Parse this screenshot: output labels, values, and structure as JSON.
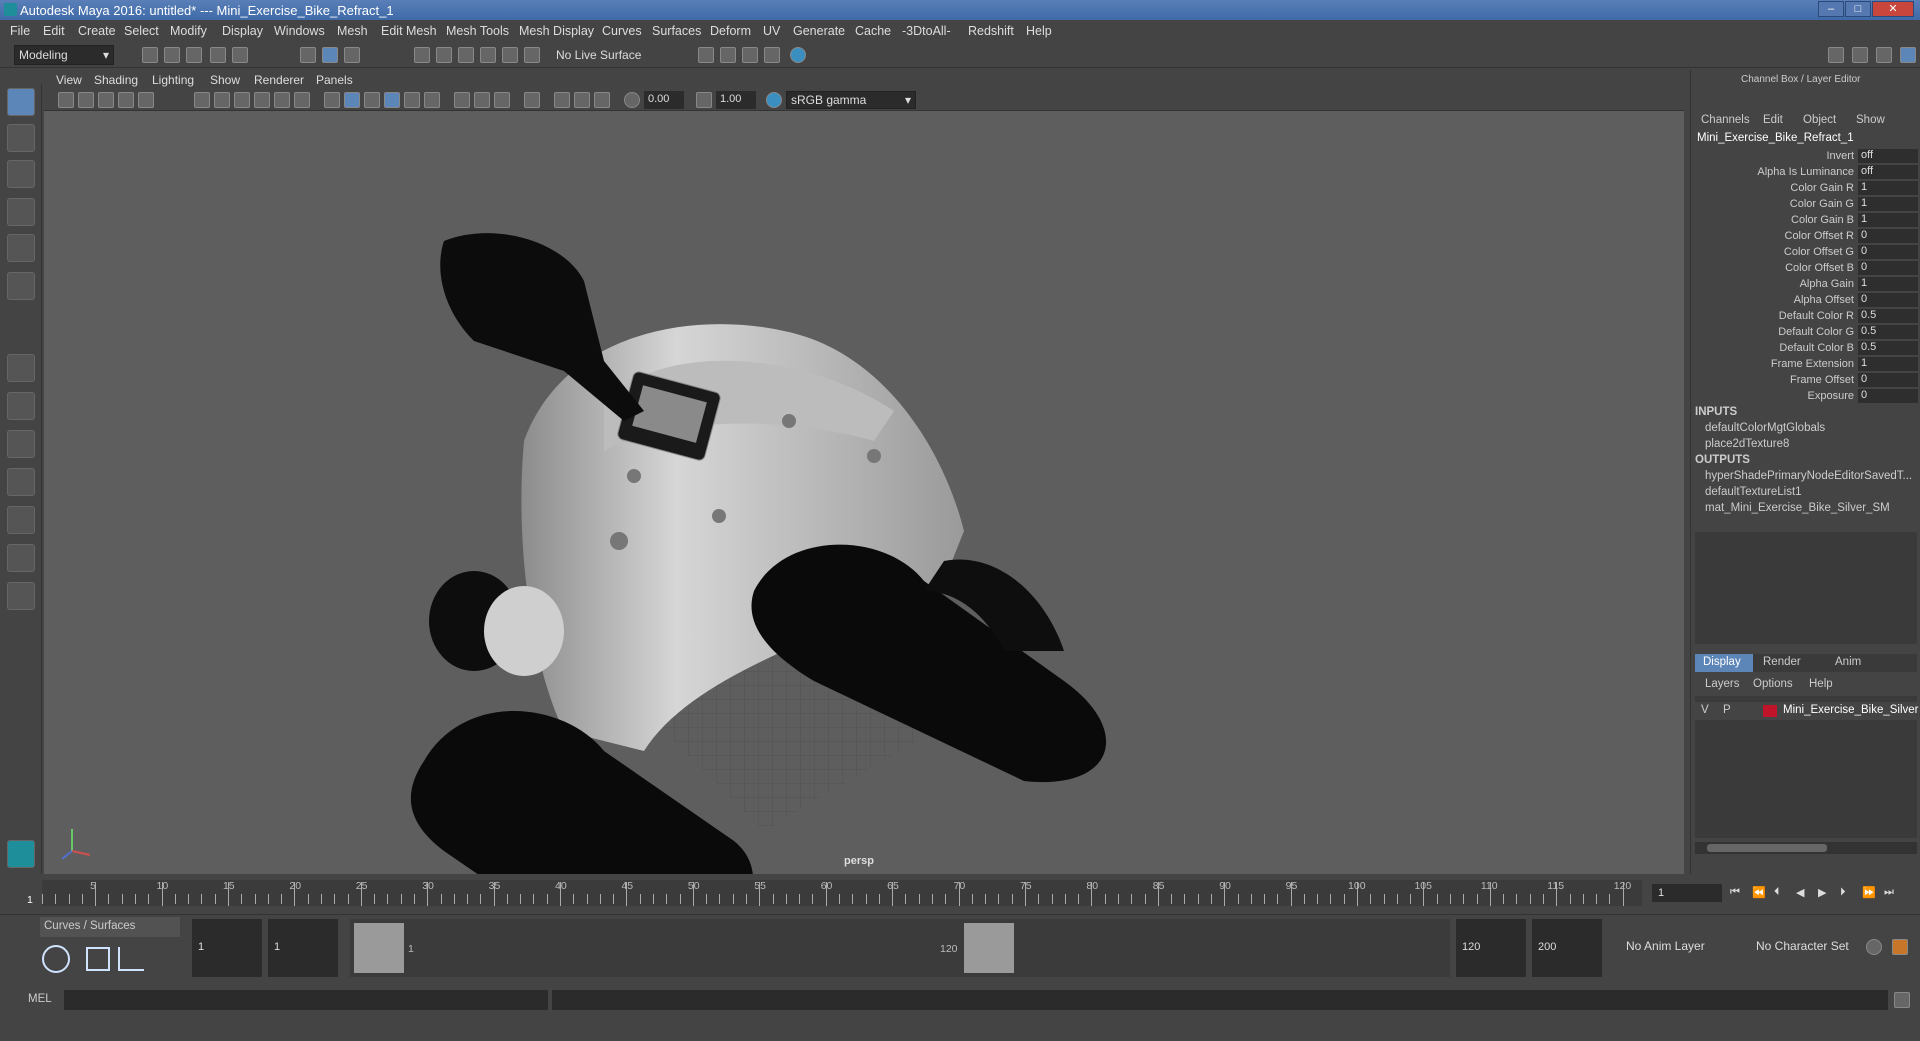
{
  "window": {
    "title": "Autodesk Maya 2016: untitled*   ---   Mini_Exercise_Bike_Refract_1",
    "min": "–",
    "max": "□",
    "close": "✕"
  },
  "menubar": [
    "File",
    "Edit",
    "Create",
    "Select",
    "Modify",
    "Display",
    "Windows",
    "Mesh",
    "Edit Mesh",
    "Mesh Tools",
    "Mesh Display",
    "Curves",
    "Surfaces",
    "Deform",
    "UV",
    "Generate",
    "Cache",
    "-3DtoAll-",
    "Redshift",
    "Help"
  ],
  "shelf": {
    "mode": "Modeling",
    "live_surface": "No Live Surface"
  },
  "viewport": {
    "menus": [
      "View",
      "Shading",
      "Lighting",
      "Show",
      "Renderer",
      "Panels"
    ],
    "exposure": "0.00",
    "gamma": "1.00",
    "colorspace": "sRGB gamma",
    "camera_label": "persp"
  },
  "channelbox": {
    "header": "Channel Box / Layer Editor",
    "menus": [
      "Channels",
      "Edit",
      "Object",
      "Show"
    ],
    "node_name": "Mini_Exercise_Bike_Refract_1",
    "attributes": [
      {
        "name": "Invert",
        "value": "off"
      },
      {
        "name": "Alpha Is Luminance",
        "value": "off"
      },
      {
        "name": "Color Gain R",
        "value": "1"
      },
      {
        "name": "Color Gain G",
        "value": "1"
      },
      {
        "name": "Color Gain B",
        "value": "1"
      },
      {
        "name": "Color Offset R",
        "value": "0"
      },
      {
        "name": "Color Offset G",
        "value": "0"
      },
      {
        "name": "Color Offset B",
        "value": "0"
      },
      {
        "name": "Alpha Gain",
        "value": "1"
      },
      {
        "name": "Alpha Offset",
        "value": "0"
      },
      {
        "name": "Default Color R",
        "value": "0.5"
      },
      {
        "name": "Default Color G",
        "value": "0.5"
      },
      {
        "name": "Default Color B",
        "value": "0.5"
      },
      {
        "name": "Frame Extension",
        "value": "1"
      },
      {
        "name": "Frame Offset",
        "value": "0"
      },
      {
        "name": "Exposure",
        "value": "0"
      }
    ],
    "inputs_label": "INPUTS",
    "inputs": [
      "defaultColorMgtGlobals",
      "place2dTexture8"
    ],
    "outputs_label": "OUTPUTS",
    "outputs": [
      "hyperShadePrimaryNodeEditorSavedT...",
      "defaultTextureList1",
      "mat_Mini_Exercise_Bike_Silver_SM"
    ],
    "layer_tabs": [
      "Display",
      "Render",
      "Anim"
    ],
    "layer_menus": [
      "Layers",
      "Options",
      "Help"
    ],
    "layer": {
      "v": "V",
      "p": "P",
      "name": "Mini_Exercise_Bike_Silver",
      "color": "#c0142a"
    }
  },
  "timeline": {
    "ticks": [
      "5",
      "10",
      "15",
      "20",
      "25",
      "30",
      "35",
      "40",
      "45",
      "50",
      "55",
      "60",
      "65",
      "70",
      "75",
      "80",
      "85",
      "90",
      "95",
      "100",
      "105",
      "110",
      "115",
      "120"
    ],
    "current_label": "1",
    "current_frame": "1"
  },
  "rangebar": {
    "tab_label": "Curves / Surfaces",
    "start": "1",
    "start2": "1",
    "range_start": "1",
    "range_end": "120",
    "end": "120",
    "end2": "200",
    "anim_layer": "No Anim Layer",
    "char_set": "No Character Set"
  },
  "cmdline": {
    "label": "MEL"
  }
}
